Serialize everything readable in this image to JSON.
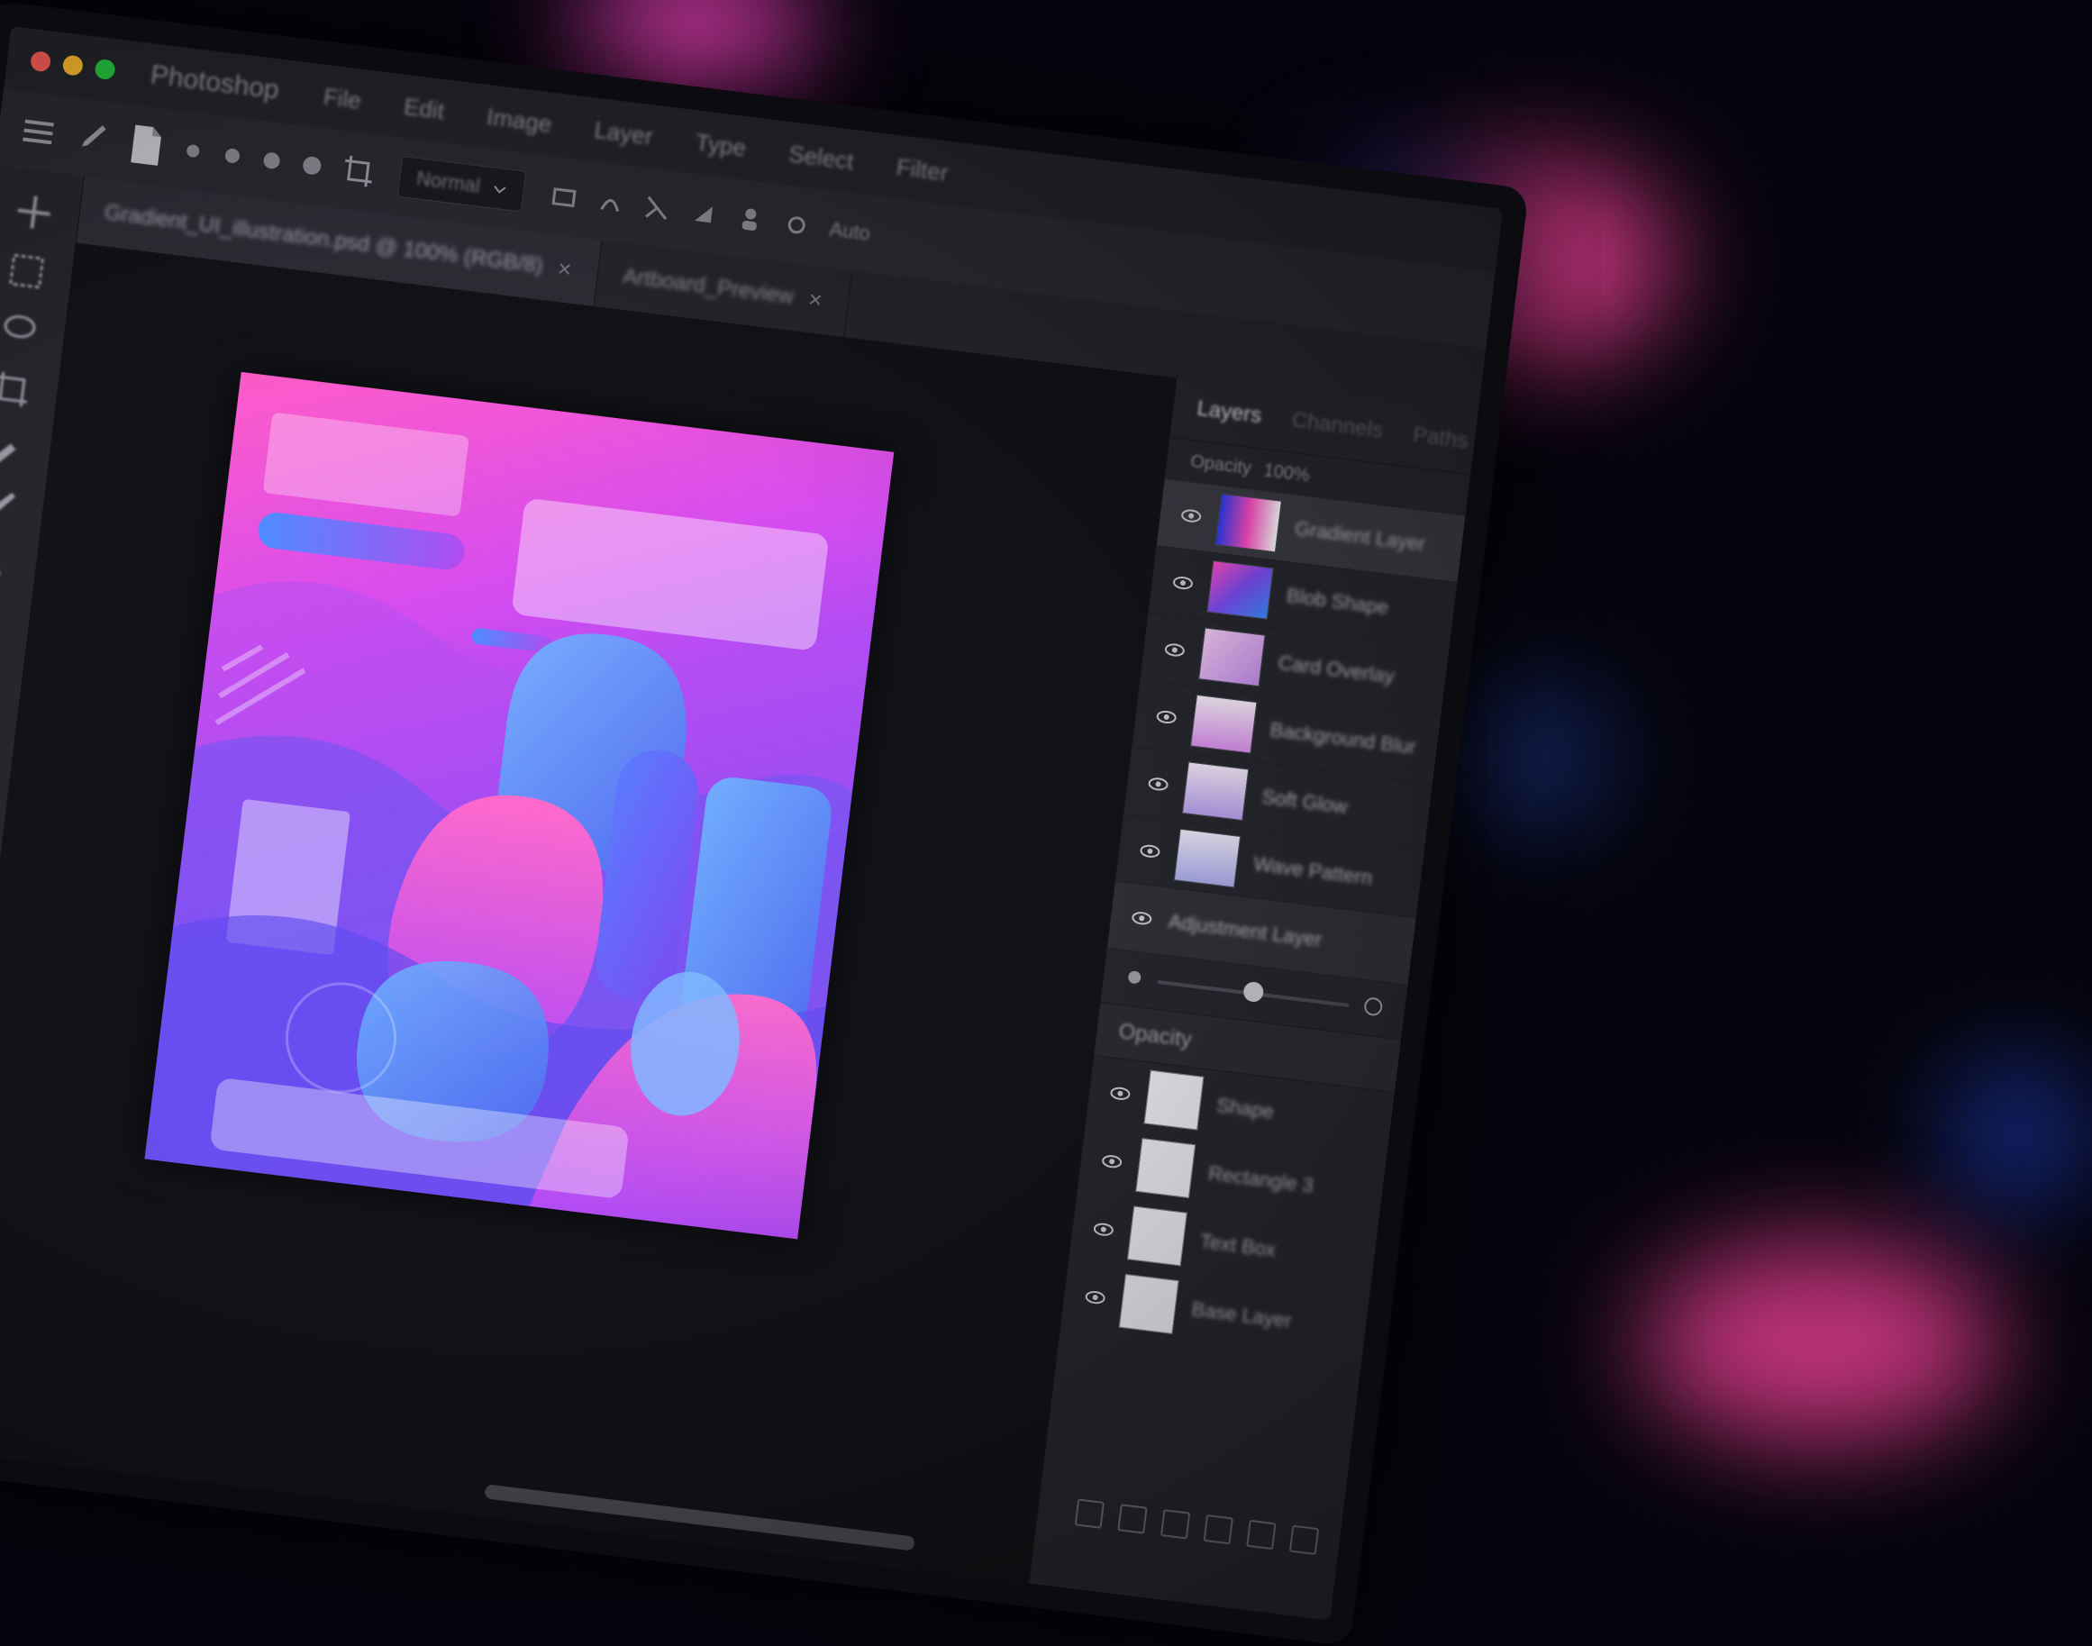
{
  "window": {
    "traffic_lights": [
      "#ff5f57",
      "#febc2e",
      "#28c840"
    ],
    "app_name": "Photoshop",
    "menu": [
      "File",
      "Edit",
      "Image",
      "Layer",
      "Type",
      "Select",
      "Filter"
    ]
  },
  "options_bar": {
    "icons": [
      "menu-icon",
      "brush-icon",
      "document-icon",
      "circle-icon",
      "circle-icon",
      "circle-icon",
      "circle-icon",
      "crop-icon"
    ],
    "select_label": "Normal",
    "share_label": "Auto"
  },
  "tabs": [
    {
      "label": "Gradient_UI_illustration.psd @ 100% (RGB/8)",
      "active": true
    },
    {
      "label": "Artboard_Preview",
      "active": false
    }
  ],
  "tools": [
    "move-icon",
    "marquee-icon",
    "lasso-icon",
    "crop-icon",
    "eyedropper-icon",
    "brush-icon",
    "pen-icon",
    "type-icon",
    "shape-icon",
    "hand-icon",
    "zoom-icon",
    "eraser-icon",
    "gradient-icon",
    "dodge-icon",
    "stamp-icon",
    "healing-icon"
  ],
  "colors": {
    "foreground": "#e43cc4",
    "background": "#3a5cf0",
    "accent": "#d64cf0"
  },
  "panel": {
    "tabs": [
      "Layers",
      "Channels",
      "Paths"
    ],
    "sub_label": "Opacity",
    "sub_value": "100%",
    "layers": [
      {
        "name": "Gradient Layer",
        "selected": true
      },
      {
        "name": "Blob Shape",
        "selected": false
      },
      {
        "name": "Card Overlay",
        "selected": false
      },
      {
        "name": "Background Blur",
        "selected": false
      },
      {
        "name": "Soft Glow",
        "selected": false
      },
      {
        "name": "Wave Pattern",
        "selected": false
      },
      {
        "name": "Adjustment Layer",
        "selected": false
      }
    ],
    "opacity_fraction": 0.5,
    "section_title": "Opacity",
    "section_layers": [
      "Shape",
      "Rectangle 3",
      "Text Box",
      "Base Layer"
    ]
  }
}
